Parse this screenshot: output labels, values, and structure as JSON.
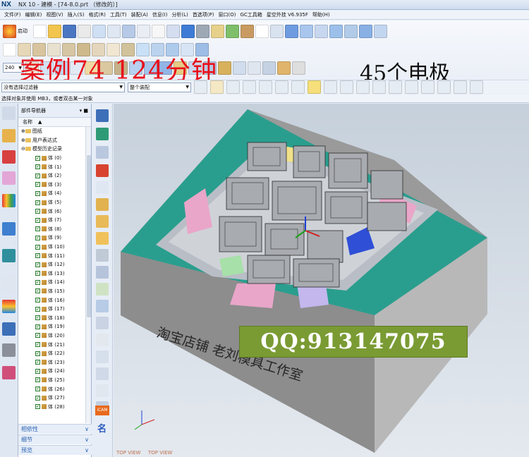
{
  "titlebar": {
    "logo": "NX",
    "title": "NX 10 - 建模 - [74-8.0.prt （修改的）]"
  },
  "menu": [
    "文件(F)",
    "编辑(E)",
    "视图(V)",
    "插入(S)",
    "格式(R)",
    "工具(T)",
    "装配(A)",
    "信息(I)",
    "分析(L)",
    "首选项(P)",
    "窗口(O)",
    "GC工具箱",
    "星空外挂 V6.935F",
    "帮助(H)"
  ],
  "toolbar": {
    "start_label": "启动",
    "zoom_value": "240"
  },
  "overlay": {
    "banner": "案例74 124分钟",
    "banner2": "45个电极",
    "qq": "QQ:913147075",
    "watermark": "淘宝店铺 老刘模具工作室"
  },
  "selection": {
    "filter": "没有选择过滤器",
    "scope": "整个装配",
    "hint": "选择对象并使用 MB3，或者双击某一对象"
  },
  "navigator": {
    "title": "部件导航器",
    "column_name": "名称",
    "drawing": "图纸",
    "user_expr": "用户表达式",
    "history": "模型历史记录",
    "bodies": [
      "体 (0)",
      "体 (1)",
      "体 (2)",
      "体 (3)",
      "体 (4)",
      "体 (5)",
      "体 (6)",
      "体 (7)",
      "体 (8)",
      "体 (9)",
      "体 (10)",
      "体 (11)",
      "体 (12)",
      "体 (13)",
      "体 (14)",
      "体 (15)",
      "体 (16)",
      "体 (17)",
      "体 (18)",
      "体 (19)",
      "体 (20)",
      "体 (21)",
      "体 (22)",
      "体 (23)",
      "体 (24)",
      "体 (25)",
      "体 (26)",
      "体 (27)",
      "体 (28)"
    ],
    "sections": [
      "相依性",
      "细节",
      "预览"
    ]
  },
  "viewport": {
    "view_label_1": "TOP VIEW",
    "view_label_2": "TOP VIEW",
    "icam_label": "iCAM",
    "ming_label": "名"
  }
}
